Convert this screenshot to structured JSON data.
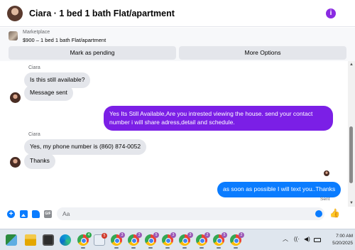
{
  "header": {
    "title": "Ciara · 1 bed 1 bath Flat/apartment",
    "info_icon": "i"
  },
  "marketplace": {
    "label": "Marketplace",
    "item": "$900 – 1 bed 1 bath Flat/apartment",
    "pending_button": "Mark as pending",
    "more_button": "More Options"
  },
  "chat": {
    "messages": [
      {
        "sender": "Ciara",
        "text": "Is this still available?",
        "direction": "in"
      },
      {
        "text": "Message sent",
        "direction": "in"
      },
      {
        "text": "Yes Its Still Available,Are you intrested viewing the house. send your contact number i will share adress,detail and schedule.",
        "direction": "out"
      },
      {
        "sender": "Ciara",
        "text": "Yes, my phone number is (860) 874-0052",
        "direction": "in"
      },
      {
        "text": "Thanks",
        "direction": "in"
      },
      {
        "text": "as soon as possible I will text you..Thanks",
        "direction": "out"
      }
    ],
    "status": "Sent"
  },
  "composer": {
    "placeholder": "Aa",
    "gif_label": "GIF"
  },
  "taskbar": {
    "badges": [
      "4",
      "5",
      "3",
      "2",
      "5",
      "3",
      "3",
      "2",
      "5",
      "2"
    ],
    "time": "7:00 AM",
    "date": "5/20/2025"
  },
  "colors": {
    "accent_purple": "#7b1fe6",
    "accent_blue": "#0a7cff",
    "bubble_gray": "#e4e6eb"
  }
}
